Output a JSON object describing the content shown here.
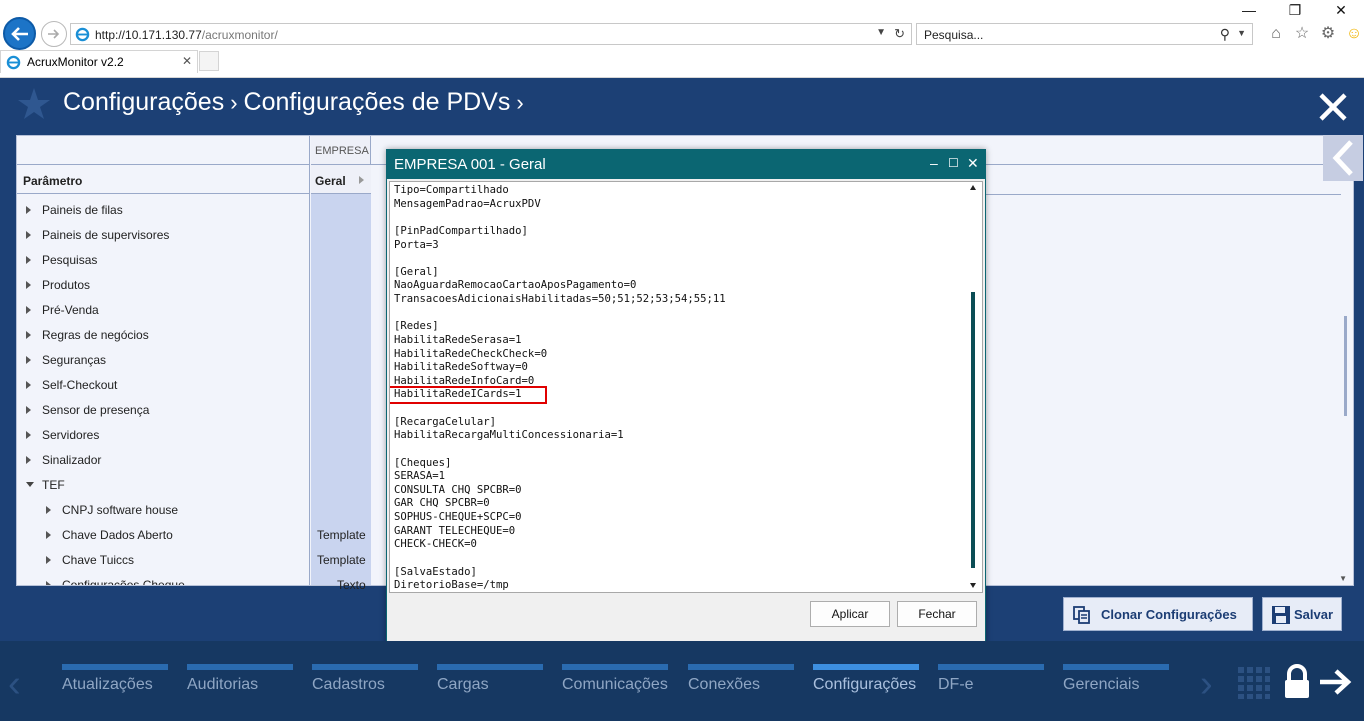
{
  "browser": {
    "url_host": "http://10.171.130.77",
    "url_path": "/acruxmonitor/",
    "search_placeholder": "Pesquisa...",
    "tab_title": "AcruxMonitor v2.2"
  },
  "header": {
    "crumb1": "Configurações",
    "crumb2": "Configurações de PDVs"
  },
  "tree": {
    "header": "Parâmetro",
    "items": [
      {
        "label": "Paineis de filas",
        "level": 0,
        "open": false
      },
      {
        "label": "Paineis de supervisores",
        "level": 0,
        "open": false
      },
      {
        "label": "Pesquisas",
        "level": 0,
        "open": false
      },
      {
        "label": "Produtos",
        "level": 0,
        "open": false
      },
      {
        "label": "Pré-Venda",
        "level": 0,
        "open": false
      },
      {
        "label": "Regras de negócios",
        "level": 0,
        "open": false
      },
      {
        "label": "Seguranças",
        "level": 0,
        "open": false
      },
      {
        "label": "Self-Checkout",
        "level": 0,
        "open": false
      },
      {
        "label": "Sensor de presença",
        "level": 0,
        "open": false
      },
      {
        "label": "Servidores",
        "level": 0,
        "open": false
      },
      {
        "label": "Sinalizador",
        "level": 0,
        "open": false
      },
      {
        "label": "TEF",
        "level": 0,
        "open": true
      },
      {
        "label": "CNPJ software house",
        "level": 1,
        "open": false
      },
      {
        "label": "Chave Dados Aberto",
        "level": 1,
        "open": false
      },
      {
        "label": "Chave Tuiccs",
        "level": 1,
        "open": false
      },
      {
        "label": "Configurações Cheque",
        "level": 1,
        "open": false
      }
    ]
  },
  "columns": {
    "empresa_header": "EMPRESA",
    "geral_header": "Geral",
    "values": [
      "Template",
      "Template",
      "Texto"
    ]
  },
  "modal": {
    "title": "EMPRESA 001 - Geral",
    "content": "Tipo=Compartilhado\nMensagemPadrao=AcruxPDV\n\n[PinPadCompartilhado]\nPorta=3\n\n[Geral]\nNaoAguardaRemocaoCartaoAposPagamento=0\nTransacoesAdicionaisHabilitadas=50;51;52;53;54;55;11\n\n[Redes]\nHabilitaRedeSerasa=1\nHabilitaRedeCheckCheck=0\nHabilitaRedeSoftway=0\nHabilitaRedeInfoCard=0\nHabilitaRedeICards=1\n\n[RecargaCelular]\nHabilitaRecargaMultiConcessionaria=1\n\n[Cheques]\nSERASA=1\nCONSULTA CHQ SPCBR=0\nGAR CHQ SPCBR=0\nSOPHUS-CHEQUE+SCPC=0\nGARANT TELECHEQUE=0\nCHECK-CHECK=0\n\n[SalvaEstado]\nDiretorioBase=/tmp",
    "apply_label": "Aplicar",
    "close_label": "Fechar"
  },
  "actions": {
    "clone_label": "Clonar Configurações",
    "save_label": "Salvar"
  },
  "bottom_nav": {
    "items": [
      "Atualizações",
      "Auditorias",
      "Cadastros",
      "Cargas",
      "Comunicações",
      "Conexões",
      "Configurações",
      "DF-e",
      "Gerenciais"
    ],
    "active": "Configurações"
  },
  "colors": {
    "app_bg": "#1c4075",
    "modal_title": "#0b6672",
    "highlight": "#e00000"
  }
}
